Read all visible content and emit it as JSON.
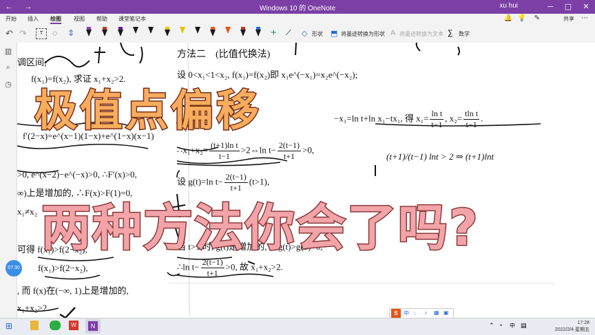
{
  "window": {
    "title": "Windows 10 的 OneNote",
    "user": "xu hui"
  },
  "menu": {
    "items": [
      "开始",
      "插入",
      "绘图",
      "视图",
      "帮助",
      "课堂笔记本"
    ],
    "active": "绘图"
  },
  "toolbar": {
    "shape_label": "形状",
    "ink_to_shape_label": "将墨迹转换为形状",
    "ink_to_text_label": "将墨迹转换为文本",
    "math_label": "数学",
    "share_label": "共享",
    "pen_colors": [
      "#1b1b1b",
      "#c0392b",
      "#1b1b1b",
      "#2b2b2b",
      "#1b1b1b",
      "#e6c300",
      "#1b1b1b",
      "#1b1b1b",
      "#e8541a",
      "#c0392b",
      "#1b1b1b",
      "#2a6ad8"
    ]
  },
  "note": {
    "left_col": [
      "调区间;",
      "f(x₁)=f(x₂), 求证 x₁+x₂>2.",
      "f′(2−x)=e^(x−1)(1−x)+e^(1−x)(x−1)",
      ">0, e^(x−2)−e^(−x)>0, ∴F′(x)>0,",
      "∞)上是增加的, ∴F(x)>F(1)=0,",
      "x₁≠x₂",
      "可得 f(x₁)>f(2−x₂),",
      "f(x₁)>f(2−x₂),",
      ", 而 f(x)在(−∞, 1)上是增加的,",
      "x₁+x₂>2."
    ],
    "method": "方法二　(比值代换法)",
    "line1": "设 0<x₁<1<x₂, f(x₁)=f(x₂)即 x₁e^(−x₁)=x₂e^(−x₂);",
    "line2_a": "−x₁=ln t+ln x₁−tx₁, 得 x₁=",
    "line2_b": "x₂=",
    "f1_num": "ln t",
    "f1_den": "t−1",
    "f2_num": "tln t",
    "f2_den": "t−1",
    "line3_a": "∴x₁+x₂=",
    "f3_num": "(t+1)ln t",
    "f3_den": "t−1",
    "line3_b": ">2⇔ln t−",
    "f4_num": "2(t−1)",
    "f4_den": "t+1",
    "line3_c": ">0,",
    "line4_a": "设 g(t)=ln t−",
    "f5_num": "2(t−1)",
    "f5_den": "t+1",
    "line4_b": "(t>1),",
    "line5": "当 t>1 时, g(t)是增加的, ∴g(t)>g(1)=0,",
    "line6_a": "∴ln t−",
    "f6_num": "2(t−1)",
    "f6_den": "t+1",
    "line6_b": ">0, 故 x₁+x₂>2.",
    "handwriting_right": "(t+1)/(t−1) lnt > 2 ⇒ (t+1)lnt"
  },
  "overlay": {
    "title1": "极值点偏移",
    "title2": "两种方法你会了吗?"
  },
  "timer": "07:30",
  "ime": {
    "label": "中"
  },
  "taskbar": {
    "time": "17:28",
    "date": "2022/2/4 星期五",
    "lang": "中"
  }
}
